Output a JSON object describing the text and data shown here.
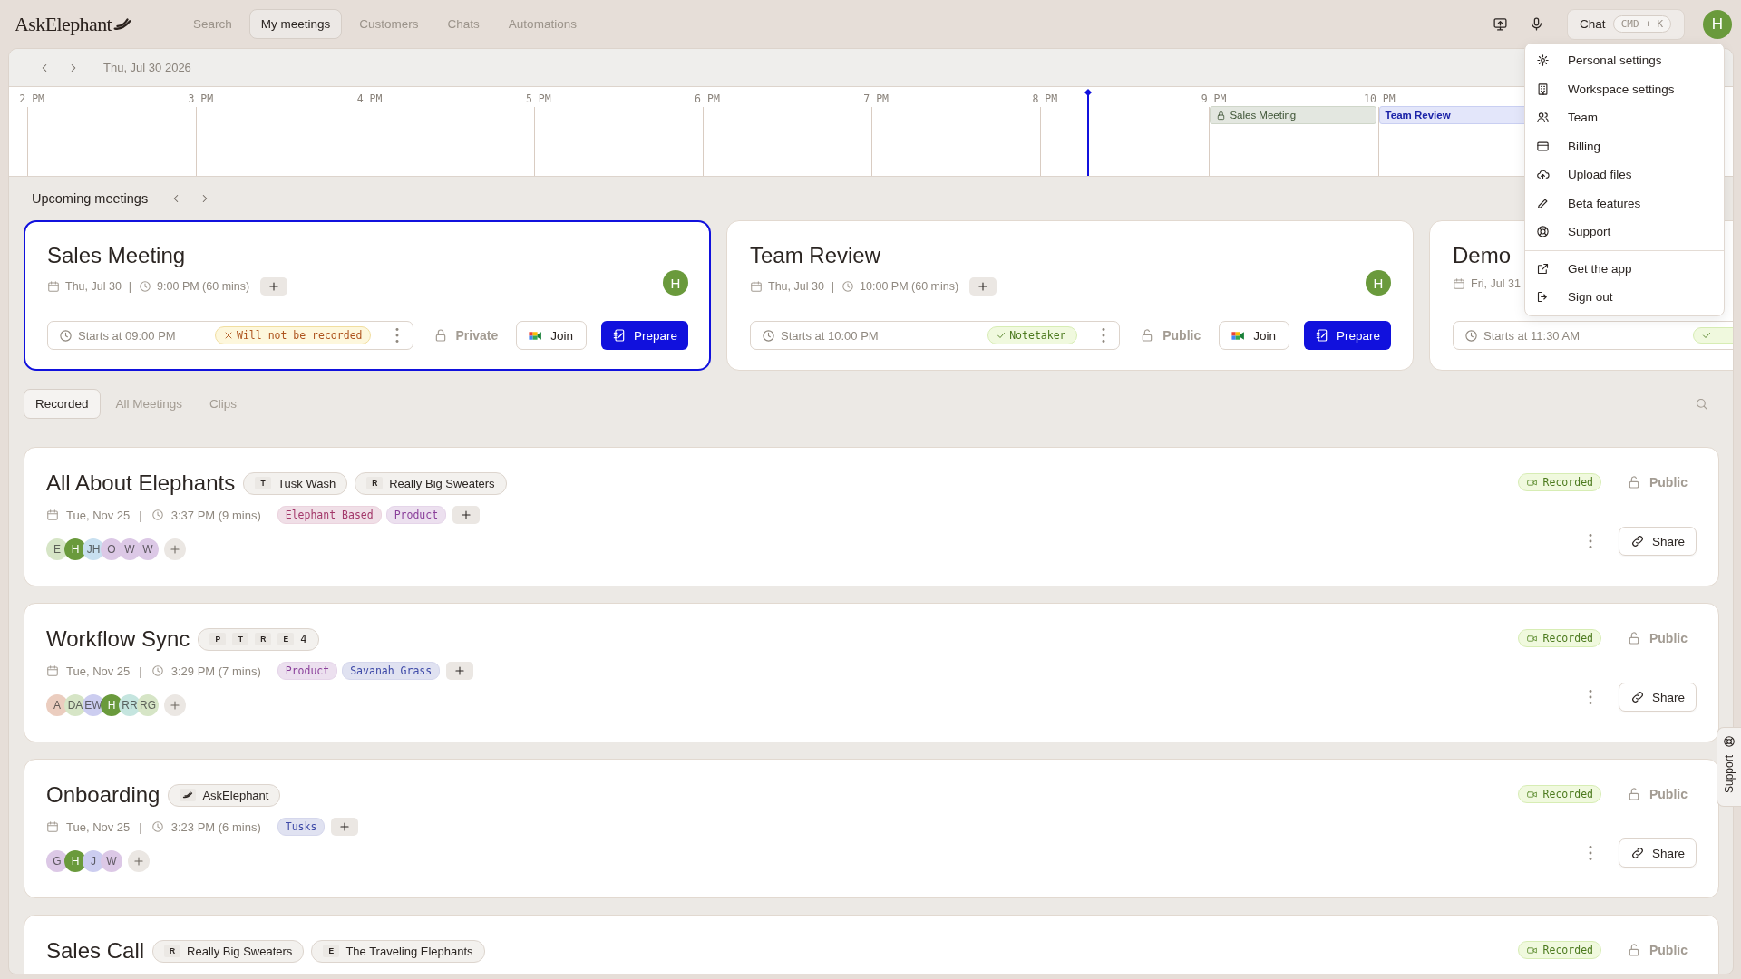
{
  "app": {
    "logo": "AskElephant"
  },
  "nav": [
    {
      "label": "Search",
      "selected": false
    },
    {
      "label": "My meetings",
      "selected": true
    },
    {
      "label": "Customers",
      "selected": false
    },
    {
      "label": "Chats",
      "selected": false
    },
    {
      "label": "Automations",
      "selected": false
    }
  ],
  "toolbar": {
    "chat_label": "Chat",
    "shortcut": "CMD + K",
    "avatar": "H"
  },
  "user_menu": {
    "sections": [
      [
        "Personal settings",
        "Workspace settings",
        "Team",
        "Billing",
        "Upload files",
        "Beta features",
        "Support"
      ],
      [
        "Get the app",
        "Sign out"
      ]
    ]
  },
  "date_bar": {
    "date": "Thu, Jul 30 2026"
  },
  "timeline": {
    "hours": [
      "2 PM",
      "3 PM",
      "4 PM",
      "5 PM",
      "6 PM",
      "7 PM",
      "8 PM",
      "9 PM",
      "10 PM"
    ],
    "events": [
      {
        "title": "Sales Meeting",
        "private": true
      },
      {
        "title": "Team Review",
        "private": false
      }
    ]
  },
  "upcoming": {
    "title": "Upcoming meetings",
    "cards": [
      {
        "title": "Sales Meeting",
        "selected": true,
        "date": "Thu, Jul 30",
        "separator": "|",
        "time": "9:00 PM (60 mins)",
        "avatar": "H",
        "starts": "Starts at 09:00 PM",
        "record_status": {
          "kind": "not_recorded",
          "label": "Will not be recorded"
        },
        "visibility": {
          "label": "Private",
          "locked": true
        },
        "join": "Join",
        "prepare": "Prepare"
      },
      {
        "title": "Team Review",
        "selected": false,
        "date": "Thu, Jul 30",
        "separator": "|",
        "time": "10:00 PM (60 mins)",
        "avatar": "H",
        "starts": "Starts at 10:00 PM",
        "record_status": {
          "kind": "notetaker",
          "label": "Notetaker"
        },
        "visibility": {
          "label": "Public",
          "locked": false
        },
        "join": "Join",
        "prepare": "Prepare"
      },
      {
        "title": "Demo",
        "selected": false,
        "date": "Fri, Jul 31",
        "starts": "Starts at 11:30 AM",
        "record_status": {
          "kind": "notetaker"
        }
      }
    ]
  },
  "tabs": [
    {
      "label": "Recorded",
      "selected": true
    },
    {
      "label": "All Meetings",
      "selected": false
    },
    {
      "label": "Clips",
      "selected": false
    }
  ],
  "meetings": [
    {
      "title": "All About Elephants",
      "companies": [
        {
          "kind": "initial",
          "initial": "T",
          "name": "Tusk Wash"
        },
        {
          "kind": "initial",
          "initial": "R",
          "name": "Really Big Sweaters"
        }
      ],
      "date": "Tue, Nov 25",
      "separator": "|",
      "time": "3:37 PM (9 mins)",
      "tags": [
        {
          "label": "Elephant Based",
          "color": "#a3386a"
        },
        {
          "label": "Product",
          "color": "#8a3f9a"
        }
      ],
      "participants": [
        {
          "initials": "E",
          "color": "#d6e5c6"
        },
        {
          "initials": "H",
          "color": "#6a9a3c"
        },
        {
          "initials": "JH",
          "color": "#c8e0f0"
        },
        {
          "initials": "O",
          "color": "#dcc8e6"
        },
        {
          "initials": "W",
          "color": "#dcc8e6"
        },
        {
          "initials": "W",
          "color": "#dcc8e6"
        }
      ],
      "status": "Recorded",
      "visibility": {
        "label": "Public",
        "locked": false
      },
      "share": "Share"
    },
    {
      "title": "Workflow Sync",
      "company_group": {
        "initials": [
          "P",
          "T",
          "R",
          "E"
        ],
        "count": "4"
      },
      "date": "Tue, Nov 25",
      "separator": "|",
      "time": "3:29 PM (7 mins)",
      "tags": [
        {
          "label": "Product",
          "color": "#8a3f9a"
        },
        {
          "label": "Savanah Grass",
          "color": "#3e4aa8"
        }
      ],
      "participants": [
        {
          "initials": "A",
          "color": "#ebcdbf"
        },
        {
          "initials": "DA",
          "color": "#d6e5c6"
        },
        {
          "initials": "EW",
          "color": "#cccdf0"
        },
        {
          "initials": "H",
          "color": "#6a9a3c"
        },
        {
          "initials": "RR",
          "color": "#c5e5df"
        },
        {
          "initials": "RG",
          "color": "#d6e5c6"
        }
      ],
      "status": "Recorded",
      "visibility": {
        "label": "Public",
        "locked": false
      },
      "share": "Share"
    },
    {
      "title": "Onboarding",
      "companies": [
        {
          "kind": "logo",
          "name": "AskElephant"
        }
      ],
      "date": "Tue, Nov 25",
      "separator": "|",
      "time": "3:23 PM (6 mins)",
      "tags": [
        {
          "label": "Tusks",
          "color": "#3e4aa8"
        }
      ],
      "participants": [
        {
          "initials": "G",
          "color": "#dcc8e6"
        },
        {
          "initials": "H",
          "color": "#6a9a3c"
        },
        {
          "initials": "J",
          "color": "#cccdf0"
        },
        {
          "initials": "W",
          "color": "#dcc8e6"
        }
      ],
      "status": "Recorded",
      "visibility": {
        "label": "Public",
        "locked": false
      },
      "share": "Share"
    },
    {
      "title": "Sales Call",
      "companies": [
        {
          "kind": "initial",
          "initial": "R",
          "name": "Really Big Sweaters"
        },
        {
          "kind": "initial",
          "initial": "E",
          "name": "The Traveling Elephants"
        }
      ],
      "status": "Recorded",
      "visibility": {
        "label": "Public",
        "locked": false
      }
    }
  ],
  "support_tab": {
    "label": "Support"
  }
}
